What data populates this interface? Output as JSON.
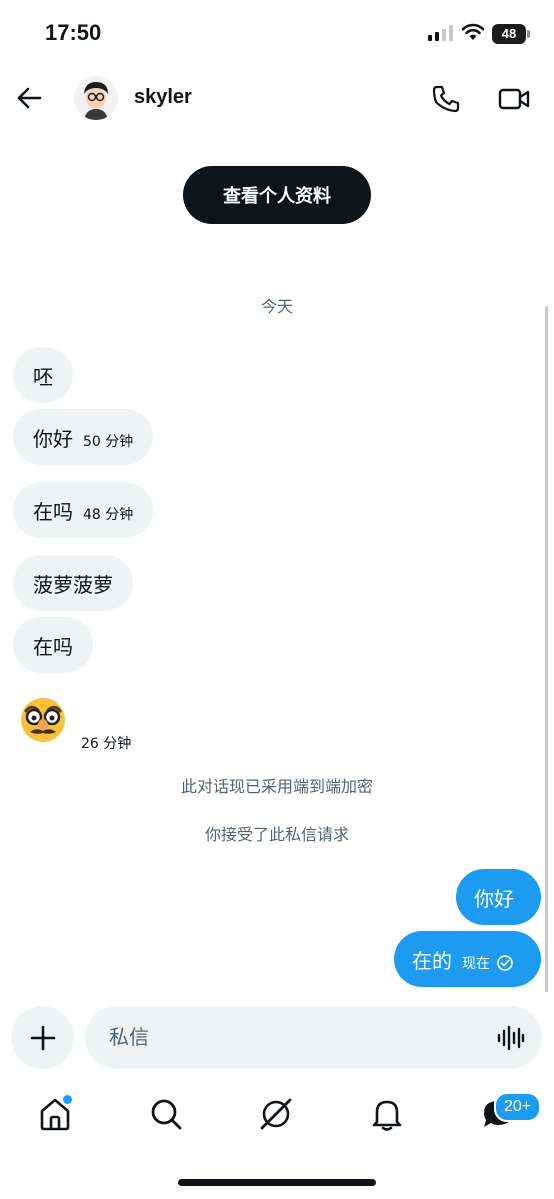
{
  "status_bar": {
    "time": "17:50",
    "battery": "48"
  },
  "header": {
    "username": "skyler"
  },
  "profile_button": "查看个人资料",
  "date_label": "今天",
  "messages_in": [
    {
      "text": "呸",
      "time": ""
    },
    {
      "text": "你好",
      "time": "50 分钟"
    },
    {
      "text": "在吗",
      "time": "48 分钟"
    },
    {
      "text": "菠萝菠萝",
      "time": ""
    },
    {
      "text": "在吗",
      "time": ""
    }
  ],
  "emoji_message": {
    "emoji": "🥸",
    "time": "26 分钟"
  },
  "system_messages": [
    "此对话现已采用端到端加密",
    "你接受了此私信请求"
  ],
  "messages_out": [
    {
      "text": "你好",
      "time": ""
    },
    {
      "text": "在的",
      "time": "现在"
    }
  ],
  "composer": {
    "placeholder": "私信"
  },
  "tabbar": {
    "message_badge": "20+"
  },
  "colors": {
    "accent": "#1d9bf0",
    "bubble_in": "#eff3f4",
    "text": "#0f1419",
    "muted": "#536471"
  }
}
